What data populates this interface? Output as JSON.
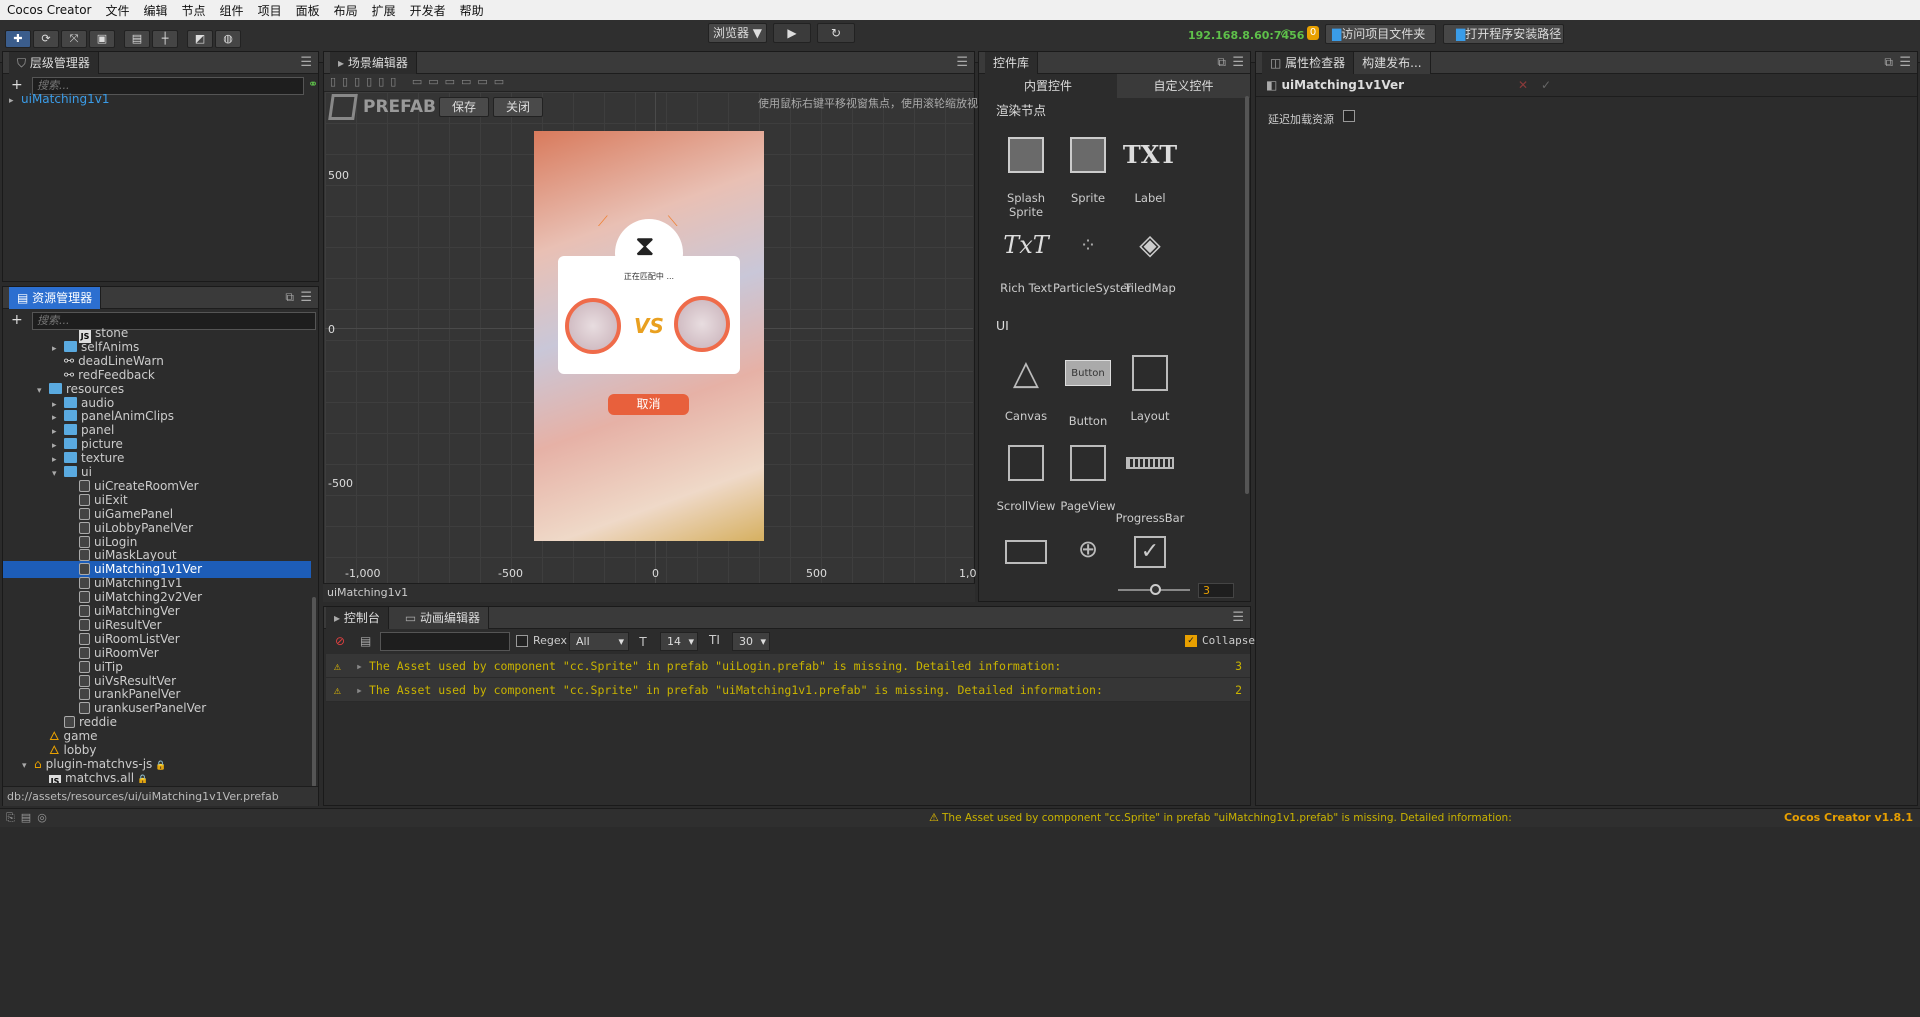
{
  "menu": [
    "Cocos Creator",
    "文件",
    "编辑",
    "节点",
    "组件",
    "项目",
    "面板",
    "布局",
    "扩展",
    "开发者",
    "帮助"
  ],
  "toolbar": {
    "preview_select": "浏览器 ▼",
    "ip": "192.168.8.60:7456",
    "badge": "0",
    "open_project_folder": "访问项目文件夹",
    "open_install_path": "打开程序安装路径"
  },
  "hierarchy": {
    "title": "层级管理器",
    "search_placeholder": "搜索...",
    "root": "uiMatching1v1"
  },
  "assets": {
    "title": "资源管理器",
    "search_placeholder": "搜索...",
    "items": [
      {
        "label": "stone",
        "type": "js",
        "indent": 4
      },
      {
        "label": "selfAnims",
        "type": "folder",
        "indent": 3,
        "arrow": "right"
      },
      {
        "label": "deadLineWarn",
        "type": "anim",
        "indent": 3
      },
      {
        "label": "redFeedback",
        "type": "anim",
        "indent": 3
      },
      {
        "label": "resources",
        "type": "folder",
        "indent": 2,
        "arrow": "down"
      },
      {
        "label": "audio",
        "type": "folder",
        "indent": 3,
        "arrow": "right"
      },
      {
        "label": "panelAnimClips",
        "type": "folder",
        "indent": 3,
        "arrow": "right"
      },
      {
        "label": "panel",
        "type": "folder",
        "indent": 3,
        "arrow": "right"
      },
      {
        "label": "picture",
        "type": "folder",
        "indent": 3,
        "arrow": "right"
      },
      {
        "label": "texture",
        "type": "folder",
        "indent": 3,
        "arrow": "right"
      },
      {
        "label": "ui",
        "type": "folder",
        "indent": 3,
        "arrow": "down"
      },
      {
        "label": "uiCreateRoomVer",
        "type": "prefab",
        "indent": 4
      },
      {
        "label": "uiExit",
        "type": "prefab",
        "indent": 4
      },
      {
        "label": "uiGamePanel",
        "type": "prefab",
        "indent": 4
      },
      {
        "label": "uiLobbyPanelVer",
        "type": "prefab",
        "indent": 4
      },
      {
        "label": "uiLogin",
        "type": "prefab",
        "indent": 4
      },
      {
        "label": "uiMaskLayout",
        "type": "prefab",
        "indent": 4
      },
      {
        "label": "uiMatching1v1Ver",
        "type": "prefab",
        "indent": 4,
        "selected": true
      },
      {
        "label": "uiMatching1v1",
        "type": "prefab",
        "indent": 4
      },
      {
        "label": "uiMatching2v2Ver",
        "type": "prefab",
        "indent": 4
      },
      {
        "label": "uiMatchingVer",
        "type": "prefab",
        "indent": 4
      },
      {
        "label": "uiResultVer",
        "type": "prefab",
        "indent": 4
      },
      {
        "label": "uiRoomListVer",
        "type": "prefab",
        "indent": 4
      },
      {
        "label": "uiRoomVer",
        "type": "prefab",
        "indent": 4
      },
      {
        "label": "uiTip",
        "type": "prefab",
        "indent": 4
      },
      {
        "label": "uiVsResultVer",
        "type": "prefab",
        "indent": 4
      },
      {
        "label": "urankPanelVer",
        "type": "prefab",
        "indent": 4
      },
      {
        "label": "urankuserPanelVer",
        "type": "prefab",
        "indent": 4
      },
      {
        "label": "reddie",
        "type": "prefab",
        "indent": 3
      },
      {
        "label": "game",
        "type": "scene",
        "indent": 2
      },
      {
        "label": "lobby",
        "type": "scene",
        "indent": 2
      },
      {
        "label": "plugin-matchvs-js",
        "type": "plugin",
        "indent": 1,
        "arrow": "down",
        "locked": true
      },
      {
        "label": "matchvs.all",
        "type": "js",
        "indent": 2,
        "locked": true
      }
    ],
    "path": "db://assets/resources/ui/uiMatching1v1Ver.prefab"
  },
  "scene": {
    "title": "场景编辑器",
    "prefab_label": "PREFAB",
    "save": "保存",
    "close": "关闭",
    "hint": "使用鼠标右键平移视窗焦点，使用滚轮缩放视图",
    "y_labels": [
      "500",
      "0",
      "-500"
    ],
    "x_labels": [
      "-1,000",
      "-500",
      "0",
      "500",
      "1,0"
    ],
    "footer": "uiMatching1v1",
    "matching_text": "正在匹配中 ...",
    "vs": "VS",
    "cancel": "取消"
  },
  "widgets": {
    "title": "控件库",
    "tab_builtin": "内置控件",
    "tab_custom": "自定义控件",
    "section_render": "渲染节点",
    "section_ui": "UI",
    "render_items": [
      "Splash Sprite",
      "Sprite",
      "Label",
      "Rich Text",
      "ParticleSyster",
      "TiledMap"
    ],
    "ui_items": [
      "Canvas",
      "Button",
      "Layout",
      "ScrollView",
      "PageView",
      "ProgressBar"
    ],
    "button_text": "Button",
    "txt_text": "TXT",
    "richtxt_text": "TxT",
    "zoom_value": "3"
  },
  "inspector": {
    "title": "属性检查器",
    "tab2": "构建发布...",
    "node_name": "uiMatching1v1Ver",
    "delay_load": "延迟加载资源"
  },
  "console": {
    "tab1": "控制台",
    "tab2": "动画编辑器",
    "regex": "Regex",
    "filter": "All",
    "font_size": "14",
    "line_height": "30",
    "collapse": "Collapse",
    "logs": [
      {
        "text": "The Asset used by component \"cc.Sprite\" in prefab \"uiLogin.prefab\" is missing. Detailed information:",
        "count": "3"
      },
      {
        "text": "The Asset used by component \"cc.Sprite\" in prefab \"uiMatching1v1.prefab\" is missing. Detailed information:",
        "count": "2"
      }
    ]
  },
  "status": {
    "message": "The Asset used by component \"cc.Sprite\" in prefab \"uiMatching1v1.prefab\" is missing. Detailed information:",
    "version": "Cocos Creator v1.8.1"
  },
  "colors": {
    "accent": "#2c6fd0",
    "warning": "#c9b300",
    "version": "#e8a000",
    "ip": "#5ec04a"
  }
}
